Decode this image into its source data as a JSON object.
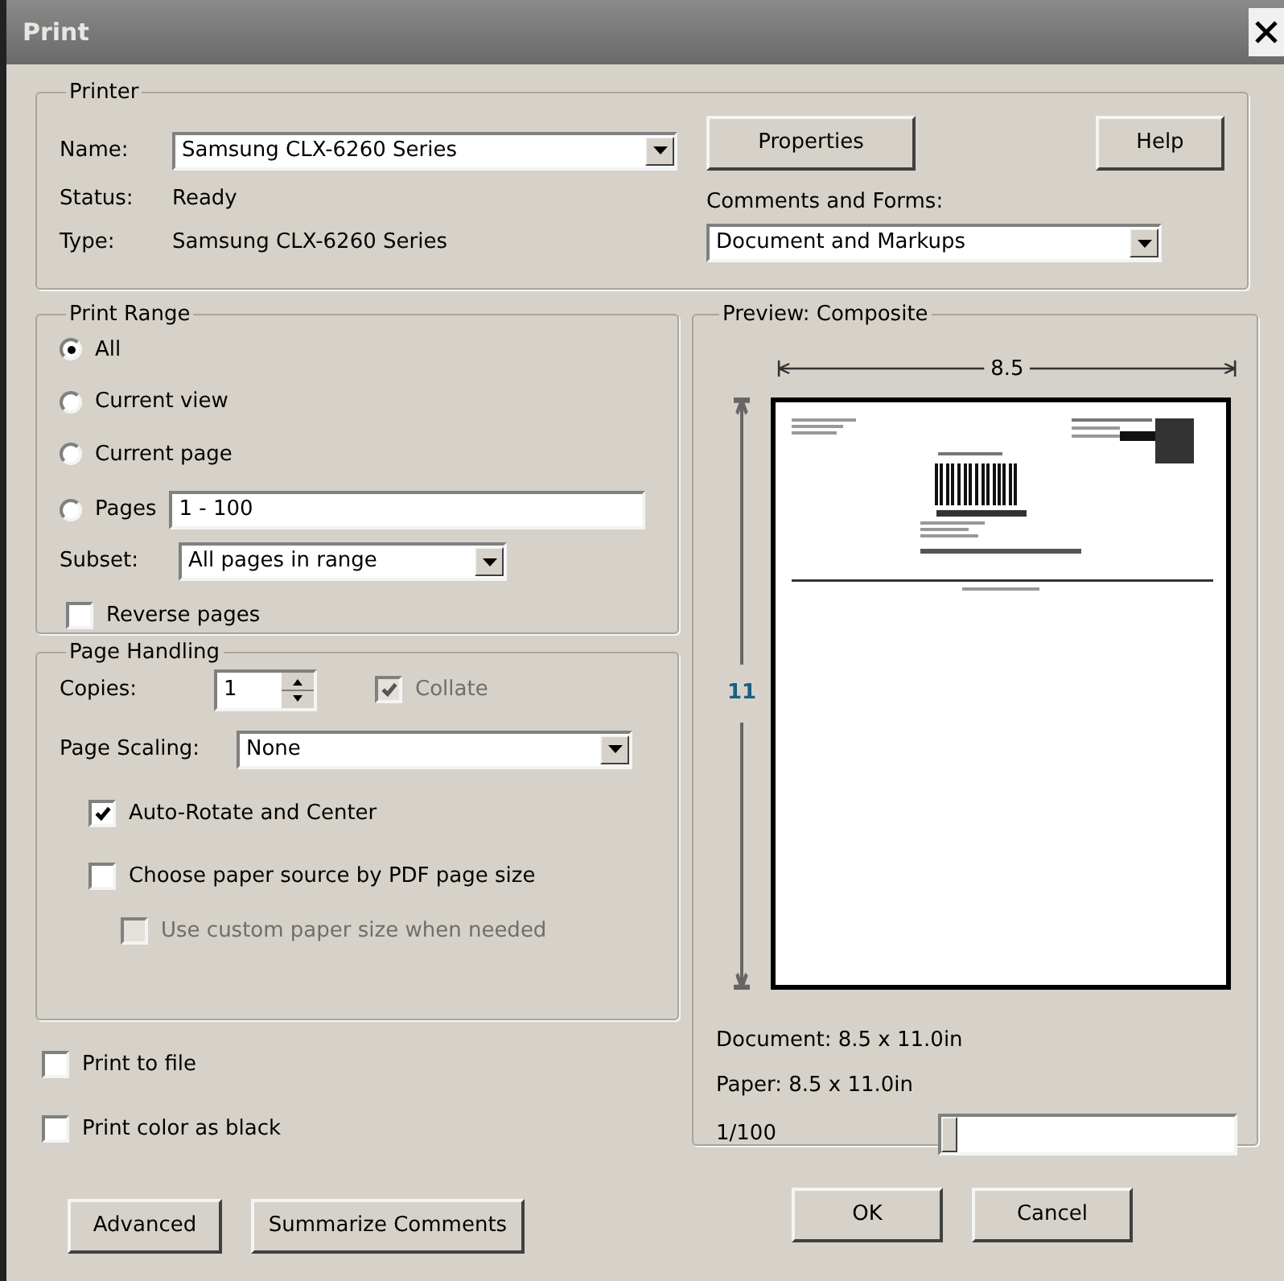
{
  "window": {
    "title": "Print"
  },
  "printer": {
    "legend": "Printer",
    "name_label": "Name:",
    "name_value": "Samsung CLX-6260 Series",
    "status_label": "Status:",
    "status": "Ready",
    "type_label": "Type:",
    "type": "Samsung CLX-6260 Series",
    "properties_button": "Properties",
    "help_button": "Help",
    "comments_label": "Comments and Forms:",
    "comments_value": "Document and Markups"
  },
  "print_range": {
    "legend": "Print Range",
    "options": [
      {
        "label": "All",
        "selected": true
      },
      {
        "label": "Current view",
        "selected": false
      },
      {
        "label": "Current page",
        "selected": false
      },
      {
        "label": "Pages",
        "selected": false
      }
    ],
    "pages_value": "1 - 100",
    "subset_label": "Subset:",
    "subset_value": "All pages in range",
    "reverse": {
      "label": "Reverse pages",
      "checked": false
    }
  },
  "page_handling": {
    "legend": "Page Handling",
    "copies_label": "Copies:",
    "copies_value": "1",
    "collate": {
      "label": "Collate",
      "checked": true,
      "disabled": true
    },
    "scaling_label": "Page Scaling:",
    "scaling_value": "None",
    "options": [
      {
        "label": "Auto-Rotate and Center",
        "checked": true,
        "disabled": false
      },
      {
        "label": "Choose paper source by PDF page size",
        "checked": false,
        "disabled": false,
        "children": [
          {
            "label": "Use custom paper size when needed",
            "checked": false,
            "disabled": true
          }
        ]
      }
    ]
  },
  "output_options": [
    {
      "label": "Print to file",
      "checked": false
    },
    {
      "label": "Print color as black",
      "checked": false
    }
  ],
  "preview": {
    "legend": "Preview: Composite",
    "width_label": "8.5",
    "height_label": "11",
    "document": "Document: 8.5 x 11.0in",
    "paper": "Paper: 8.5 x 11.0in",
    "page_counter": "1/100",
    "level": 0
  },
  "buttons_left": [
    "Advanced",
    "Summarize Comments"
  ],
  "buttons_right": [
    "OK",
    "Cancel"
  ]
}
